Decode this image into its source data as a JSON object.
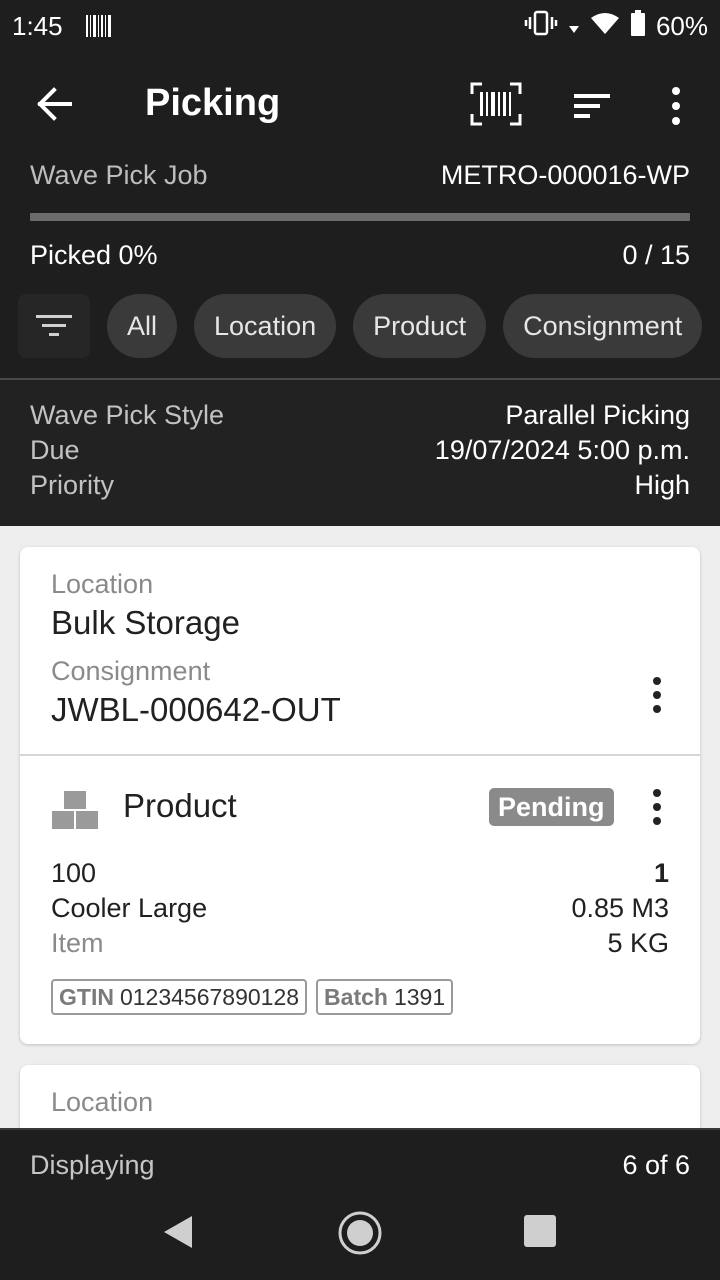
{
  "status_bar": {
    "time": "1:45",
    "battery": "60%"
  },
  "app_bar": {
    "title": "Picking"
  },
  "job": {
    "label": "Wave Pick Job",
    "id": "METRO-000016-WP",
    "picked_label": "Picked 0%",
    "picked_count": "0 / 15",
    "progress_fraction": 0.0
  },
  "filter_chips": [
    "All",
    "Location",
    "Product",
    "Consignment"
  ],
  "wave": {
    "style_label": "Wave Pick Style",
    "style_value": "Parallel Picking",
    "due_label": "Due",
    "due_value": "19/07/2024 5:00 p.m.",
    "priority_label": "Priority",
    "priority_value": "High"
  },
  "cards": [
    {
      "location_label": "Location",
      "location": "Bulk Storage",
      "consignment_label": "Consignment",
      "consignment": "JWBL-000642-OUT",
      "product_label": "Product",
      "status": "Pending",
      "code": "100",
      "quantity": "1",
      "name": "Cooler Large",
      "volume": "0.85 M3",
      "type": "Item",
      "weight": "5 KG",
      "gtin_label": "GTIN",
      "gtin": "01234567890128",
      "batch_label": "Batch",
      "batch": "1391"
    },
    {
      "location_label": "Location"
    }
  ],
  "footer": {
    "displaying_label": "Displaying",
    "displaying_value": "6 of 6"
  }
}
